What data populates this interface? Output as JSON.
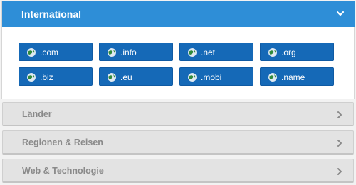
{
  "open_section": {
    "title": "International"
  },
  "tlds": [
    ".com",
    ".info",
    ".net",
    ".org",
    ".biz",
    ".eu",
    ".mobi",
    ".name"
  ],
  "sections": [
    {
      "label": "Länder"
    },
    {
      "label": "Regionen & Reisen"
    },
    {
      "label": "Web & Technologie"
    }
  ],
  "icons": {
    "expand": "chevron-down-icon",
    "collapsed": "chevron-right-icon",
    "tld": "globe-icon"
  },
  "colors": {
    "header": "#2e8ed7",
    "button": "#1569b7",
    "bar": "#e3e3e3"
  }
}
